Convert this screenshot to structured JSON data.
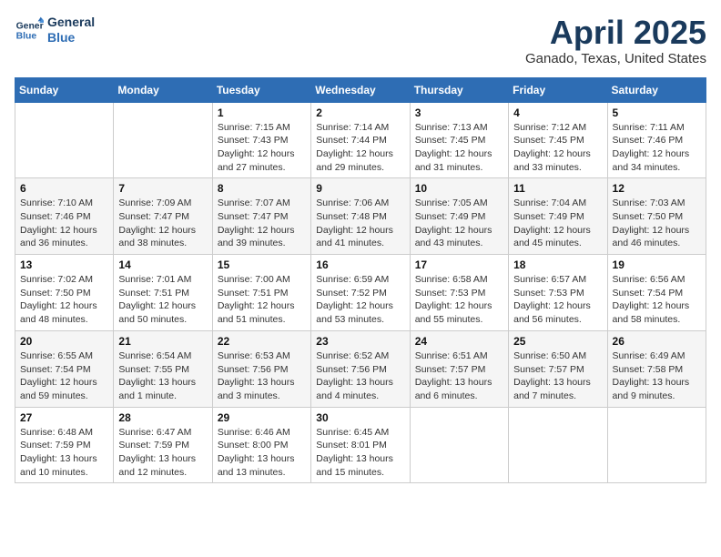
{
  "header": {
    "logo_line1": "General",
    "logo_line2": "Blue",
    "month": "April 2025",
    "location": "Ganado, Texas, United States"
  },
  "weekdays": [
    "Sunday",
    "Monday",
    "Tuesday",
    "Wednesday",
    "Thursday",
    "Friday",
    "Saturday"
  ],
  "weeks": [
    [
      {
        "day": "",
        "info": ""
      },
      {
        "day": "",
        "info": ""
      },
      {
        "day": "1",
        "info": "Sunrise: 7:15 AM\nSunset: 7:43 PM\nDaylight: 12 hours\nand 27 minutes."
      },
      {
        "day": "2",
        "info": "Sunrise: 7:14 AM\nSunset: 7:44 PM\nDaylight: 12 hours\nand 29 minutes."
      },
      {
        "day": "3",
        "info": "Sunrise: 7:13 AM\nSunset: 7:45 PM\nDaylight: 12 hours\nand 31 minutes."
      },
      {
        "day": "4",
        "info": "Sunrise: 7:12 AM\nSunset: 7:45 PM\nDaylight: 12 hours\nand 33 minutes."
      },
      {
        "day": "5",
        "info": "Sunrise: 7:11 AM\nSunset: 7:46 PM\nDaylight: 12 hours\nand 34 minutes."
      }
    ],
    [
      {
        "day": "6",
        "info": "Sunrise: 7:10 AM\nSunset: 7:46 PM\nDaylight: 12 hours\nand 36 minutes."
      },
      {
        "day": "7",
        "info": "Sunrise: 7:09 AM\nSunset: 7:47 PM\nDaylight: 12 hours\nand 38 minutes."
      },
      {
        "day": "8",
        "info": "Sunrise: 7:07 AM\nSunset: 7:47 PM\nDaylight: 12 hours\nand 39 minutes."
      },
      {
        "day": "9",
        "info": "Sunrise: 7:06 AM\nSunset: 7:48 PM\nDaylight: 12 hours\nand 41 minutes."
      },
      {
        "day": "10",
        "info": "Sunrise: 7:05 AM\nSunset: 7:49 PM\nDaylight: 12 hours\nand 43 minutes."
      },
      {
        "day": "11",
        "info": "Sunrise: 7:04 AM\nSunset: 7:49 PM\nDaylight: 12 hours\nand 45 minutes."
      },
      {
        "day": "12",
        "info": "Sunrise: 7:03 AM\nSunset: 7:50 PM\nDaylight: 12 hours\nand 46 minutes."
      }
    ],
    [
      {
        "day": "13",
        "info": "Sunrise: 7:02 AM\nSunset: 7:50 PM\nDaylight: 12 hours\nand 48 minutes."
      },
      {
        "day": "14",
        "info": "Sunrise: 7:01 AM\nSunset: 7:51 PM\nDaylight: 12 hours\nand 50 minutes."
      },
      {
        "day": "15",
        "info": "Sunrise: 7:00 AM\nSunset: 7:51 PM\nDaylight: 12 hours\nand 51 minutes."
      },
      {
        "day": "16",
        "info": "Sunrise: 6:59 AM\nSunset: 7:52 PM\nDaylight: 12 hours\nand 53 minutes."
      },
      {
        "day": "17",
        "info": "Sunrise: 6:58 AM\nSunset: 7:53 PM\nDaylight: 12 hours\nand 55 minutes."
      },
      {
        "day": "18",
        "info": "Sunrise: 6:57 AM\nSunset: 7:53 PM\nDaylight: 12 hours\nand 56 minutes."
      },
      {
        "day": "19",
        "info": "Sunrise: 6:56 AM\nSunset: 7:54 PM\nDaylight: 12 hours\nand 58 minutes."
      }
    ],
    [
      {
        "day": "20",
        "info": "Sunrise: 6:55 AM\nSunset: 7:54 PM\nDaylight: 12 hours\nand 59 minutes."
      },
      {
        "day": "21",
        "info": "Sunrise: 6:54 AM\nSunset: 7:55 PM\nDaylight: 13 hours\nand 1 minute."
      },
      {
        "day": "22",
        "info": "Sunrise: 6:53 AM\nSunset: 7:56 PM\nDaylight: 13 hours\nand 3 minutes."
      },
      {
        "day": "23",
        "info": "Sunrise: 6:52 AM\nSunset: 7:56 PM\nDaylight: 13 hours\nand 4 minutes."
      },
      {
        "day": "24",
        "info": "Sunrise: 6:51 AM\nSunset: 7:57 PM\nDaylight: 13 hours\nand 6 minutes."
      },
      {
        "day": "25",
        "info": "Sunrise: 6:50 AM\nSunset: 7:57 PM\nDaylight: 13 hours\nand 7 minutes."
      },
      {
        "day": "26",
        "info": "Sunrise: 6:49 AM\nSunset: 7:58 PM\nDaylight: 13 hours\nand 9 minutes."
      }
    ],
    [
      {
        "day": "27",
        "info": "Sunrise: 6:48 AM\nSunset: 7:59 PM\nDaylight: 13 hours\nand 10 minutes."
      },
      {
        "day": "28",
        "info": "Sunrise: 6:47 AM\nSunset: 7:59 PM\nDaylight: 13 hours\nand 12 minutes."
      },
      {
        "day": "29",
        "info": "Sunrise: 6:46 AM\nSunset: 8:00 PM\nDaylight: 13 hours\nand 13 minutes."
      },
      {
        "day": "30",
        "info": "Sunrise: 6:45 AM\nSunset: 8:01 PM\nDaylight: 13 hours\nand 15 minutes."
      },
      {
        "day": "",
        "info": ""
      },
      {
        "day": "",
        "info": ""
      },
      {
        "day": "",
        "info": ""
      }
    ]
  ]
}
